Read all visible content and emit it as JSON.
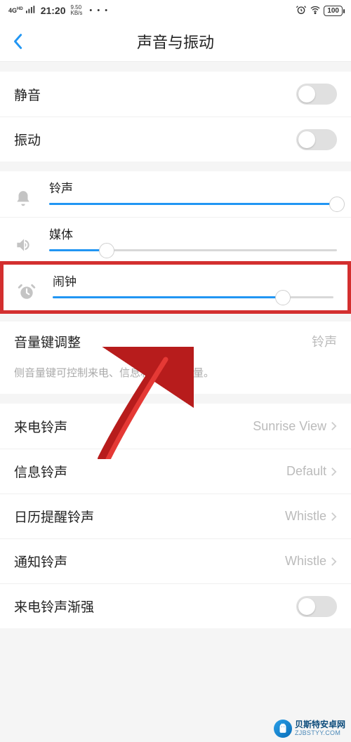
{
  "status": {
    "network": "4G",
    "hd": "HD",
    "time": "21:20",
    "speed_value": "9.50",
    "speed_unit": "KB/s",
    "dots": "• • •",
    "battery": "100"
  },
  "nav": {
    "title": "声音与振动"
  },
  "toggles": {
    "mute_label": "静音",
    "mute_on": false,
    "vibrate_label": "振动",
    "vibrate_on": false
  },
  "sliders": {
    "ringtone": {
      "label": "铃声",
      "value": 100
    },
    "media": {
      "label": "媒体",
      "value": 20
    },
    "alarm": {
      "label": "闹钟",
      "value": 82
    }
  },
  "volume_key": {
    "label": "音量键调整",
    "value": "铃声",
    "desc": "侧音量键可控制来电、信息和通知的音量。"
  },
  "ringtones": {
    "incoming_label": "来电铃声",
    "incoming_value": "Sunrise View",
    "message_label": "信息铃声",
    "message_value": "Default",
    "calendar_label": "日历提醒铃声",
    "calendar_value": "Whistle",
    "notify_label": "通知铃声",
    "notify_value": "Whistle",
    "ascending_label": "来电铃声渐强",
    "ascending_on": false
  },
  "watermark": {
    "name": "贝斯特安卓网",
    "url": "ZJBSTYY.COM"
  },
  "colors": {
    "accent": "#2196f3",
    "highlight": "#d32f2f"
  }
}
